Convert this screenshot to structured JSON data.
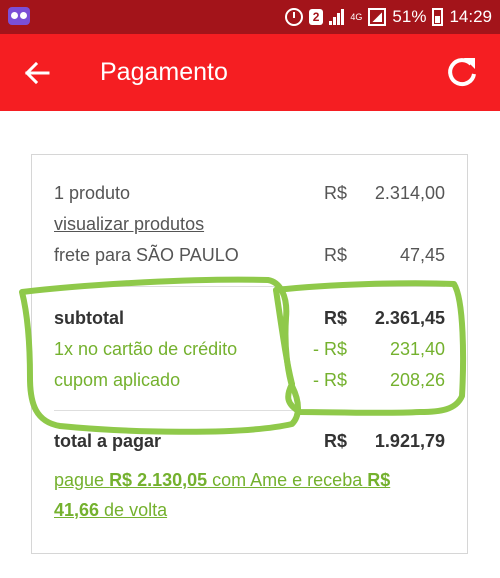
{
  "status_bar": {
    "badge": "2",
    "network": "4G",
    "battery": "51%",
    "time": "14:29"
  },
  "app_bar": {
    "title": "Pagamento"
  },
  "summary": {
    "products": {
      "label": "1 produto",
      "currency": "R$",
      "value": "2.314,00"
    },
    "view_products_link": "visualizar produtos",
    "shipping": {
      "label": "frete para SÃO PAULO",
      "currency": "R$",
      "value": "47,45"
    },
    "subtotal": {
      "label": "subtotal",
      "currency": "R$",
      "value": "2.361,45"
    },
    "credit_card": {
      "label": "1x no cartão de crédito",
      "currency": "- R$",
      "value": "231,40"
    },
    "coupon": {
      "label": "cupom aplicado",
      "currency": "- R$",
      "value": "208,26"
    },
    "total": {
      "label": "total a pagar",
      "currency": "R$",
      "value": "1.921,79"
    },
    "ame_offer": {
      "prefix": "pague ",
      "pay_amount": "R$ 2.130,05",
      "middle": " com Ame e receba ",
      "cashback_currency": "R$",
      "cashback_value": "41,66",
      "suffix": " de volta"
    }
  },
  "colors": {
    "status_bar": "#a3141a",
    "app_bar": "#f51e22",
    "discount_green": "#74b12e",
    "highlight_scribble": "#8fc94a"
  }
}
